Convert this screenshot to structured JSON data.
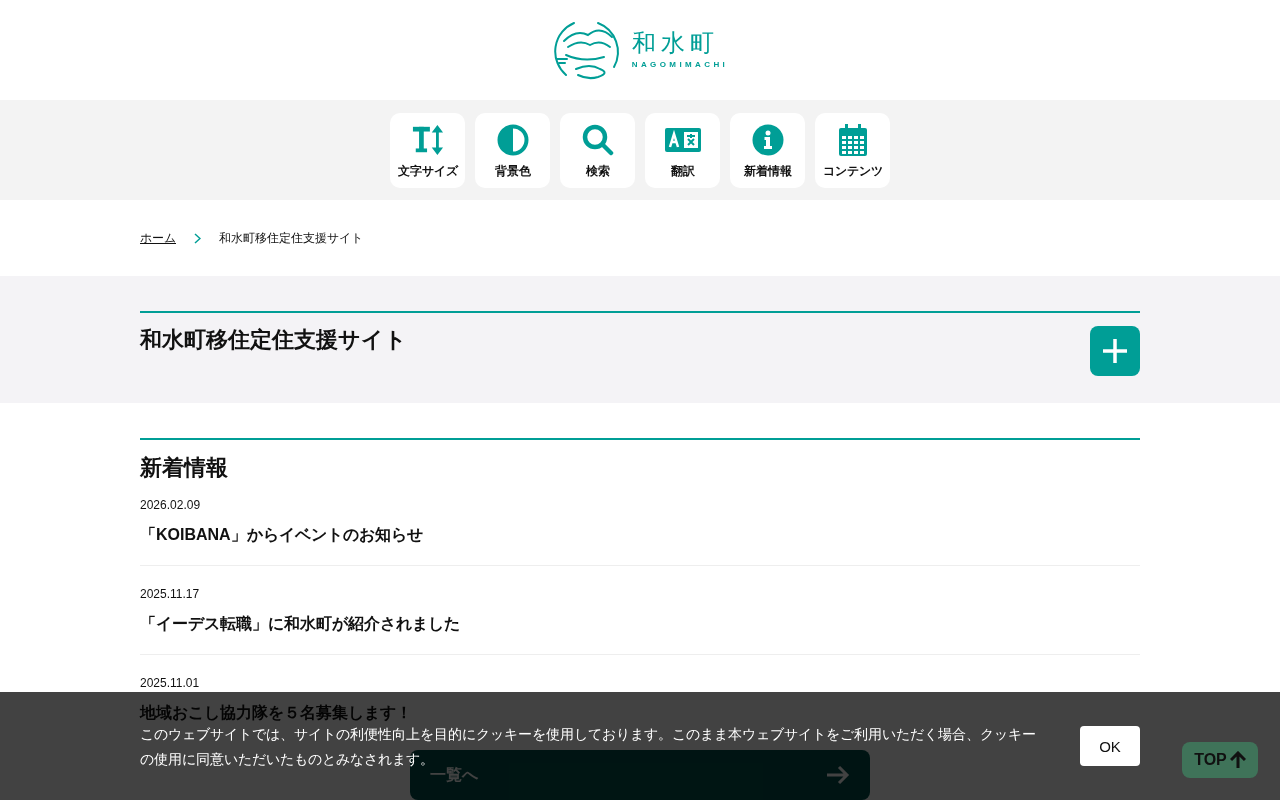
{
  "logo": {
    "name": "和水町",
    "roman": "NAGOMIMACHI"
  },
  "toolbar": [
    {
      "kind": "text_size",
      "label": "文字サイズ"
    },
    {
      "kind": "contrast",
      "label": "背景色"
    },
    {
      "kind": "search",
      "label": "検索"
    },
    {
      "kind": "translate",
      "label": "翻訳"
    },
    {
      "kind": "info",
      "label": "新着情報"
    },
    {
      "kind": "calendar",
      "label": "コンテンツ"
    }
  ],
  "breadcrumb": [
    {
      "label": "ホーム",
      "link": true
    },
    {
      "label": "和水町移住定住支援サイト",
      "link": false
    }
  ],
  "page_title": "和水町移住定住支援サイト",
  "news": {
    "heading": "新着情報",
    "items": [
      {
        "date": "2026.02.09",
        "title": "「KOIBANA」からイベントのお知らせ"
      },
      {
        "date": "2025.11.17",
        "title": "「イーデス転職」に和水町が紹介されました"
      },
      {
        "date": "2025.11.01",
        "title": "地域おこし協力隊を５名募集します！"
      }
    ],
    "more_button": "一覧へ"
  },
  "cookie": {
    "text": "このウェブサイトでは、サイトの利便性向上を目的にクッキーを使用しております。このまま本ウェブサイトをご利用いただく場合、クッキーの使用に同意いただいたものとみなされます。",
    "button": "OK"
  },
  "top_button": "TOP"
}
